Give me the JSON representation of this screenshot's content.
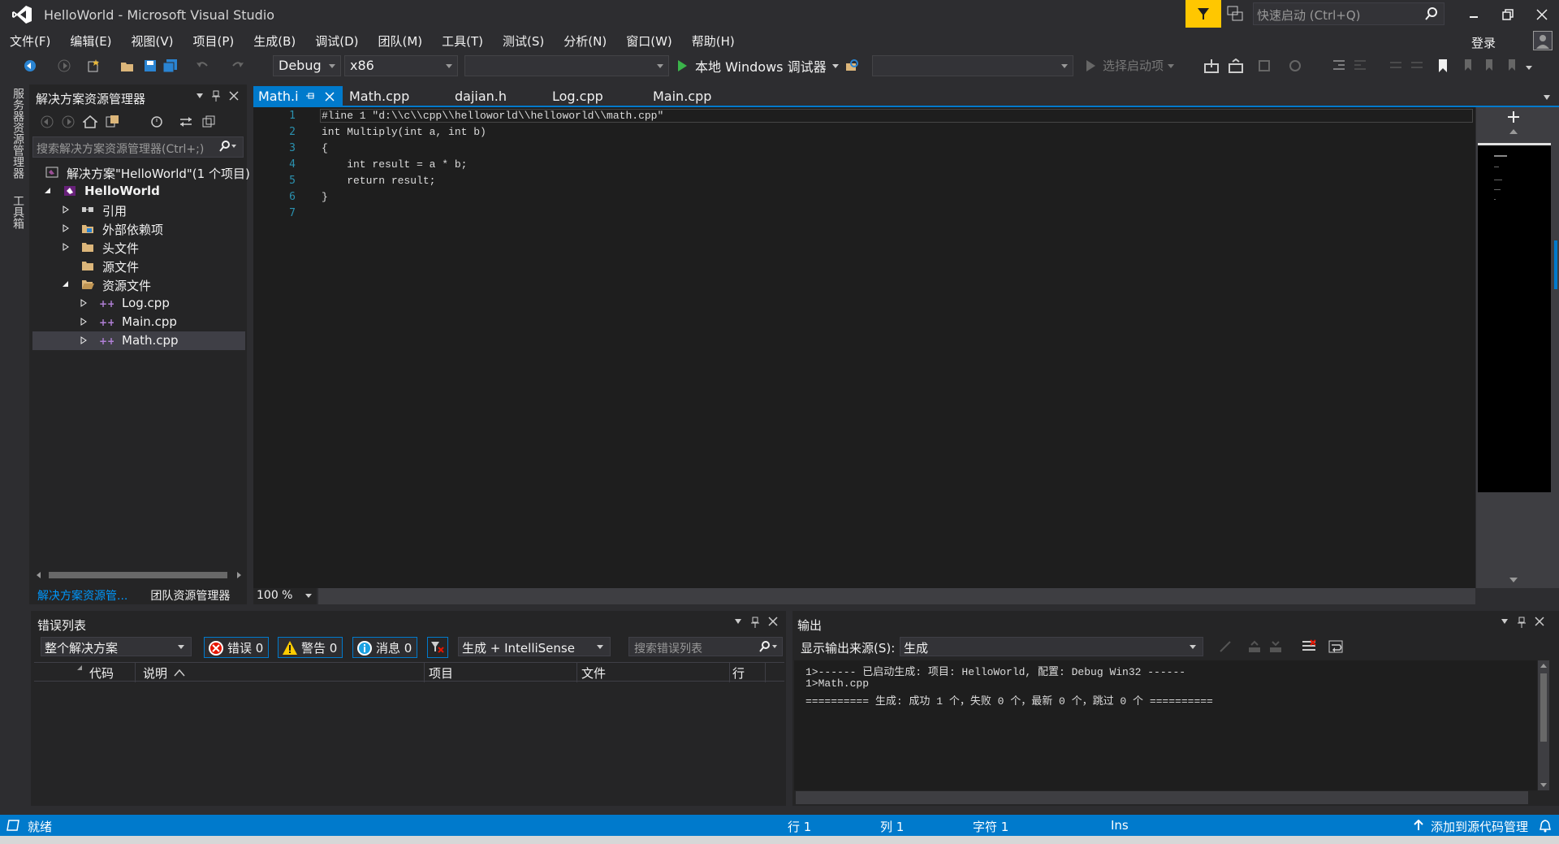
{
  "window": {
    "title": "HelloWorld - Microsoft Visual Studio",
    "quick_launch_placeholder": "快速启动 (Ctrl+Q)",
    "sign_in": "登录"
  },
  "menu": [
    "文件(F)",
    "编辑(E)",
    "视图(V)",
    "项目(P)",
    "生成(B)",
    "调试(D)",
    "团队(M)",
    "工具(T)",
    "测试(S)",
    "分析(N)",
    "窗口(W)",
    "帮助(H)"
  ],
  "toolbar": {
    "config": "Debug",
    "platform": "x86",
    "run_label": "本地 Windows 调试器",
    "startup_label": "选择启动项"
  },
  "side_tabs": [
    "服务器资源管理器",
    "工具箱"
  ],
  "solution_explorer": {
    "title": "解决方案资源管理器",
    "search_placeholder": "搜索解决方案资源管理器(Ctrl+;)",
    "tree": [
      {
        "label": "解决方案\"HelloWorld\"(1 个项目)",
        "icon": "solution-icon",
        "expander": ""
      },
      {
        "label": "HelloWorld",
        "icon": "project-icon",
        "expander": "expanded"
      },
      {
        "label": "引用",
        "icon": "references-icon",
        "expander": "collapsed"
      },
      {
        "label": "外部依赖项",
        "icon": "external-deps-icon",
        "expander": "collapsed"
      },
      {
        "label": "头文件",
        "icon": "folder-icon",
        "expander": "collapsed"
      },
      {
        "label": "源文件",
        "icon": "folder-icon",
        "expander": ""
      },
      {
        "label": "资源文件",
        "icon": "folder-open-icon",
        "expander": "expanded"
      },
      {
        "label": "Log.cpp",
        "icon": "cpp-file-icon",
        "expander": "collapsed"
      },
      {
        "label": "Main.cpp",
        "icon": "cpp-file-icon",
        "expander": "collapsed"
      },
      {
        "label": "Math.cpp",
        "icon": "cpp-file-icon",
        "expander": "collapsed",
        "selected": true
      }
    ],
    "bottom_tabs": [
      "解决方案资源管...",
      "团队资源管理器"
    ]
  },
  "editor": {
    "tabs": [
      "Math.i",
      "Math.cpp",
      "dajian.h",
      "Log.cpp",
      "Main.cpp"
    ],
    "active_tab": "Math.i",
    "zoom": "100 %",
    "lines": [
      "#line 1 \"d:\\\\c\\\\cpp\\\\helloworld\\\\helloworld\\\\math.cpp\"",
      "int Multiply(int a, int b)",
      "{",
      "    int result = a * b;",
      "    return result;",
      "}",
      ""
    ],
    "line_numbers": [
      "1",
      "2",
      "3",
      "4",
      "5",
      "6",
      "7"
    ]
  },
  "error_list": {
    "title": "错误列表",
    "scope": "整个解决方案",
    "errors": "错误 0",
    "warnings": "警告 0",
    "messages": "消息 0",
    "build_filter": "生成 + IntelliSense",
    "search_placeholder": "搜索错误列表",
    "columns": [
      "代码",
      "说明",
      "项目",
      "文件",
      "行"
    ]
  },
  "output": {
    "title": "输出",
    "source_label": "显示输出来源(S):",
    "source_value": "生成",
    "lines": [
      "1>------ 已启动生成: 项目: HelloWorld, 配置: Debug Win32 ------",
      "1>Math.cpp",
      "========== 生成: 成功 1 个，失败 0 个，最新 0 个，跳过 0 个 =========="
    ]
  },
  "status": {
    "state": "就绪",
    "row": "行 1",
    "col": "列 1",
    "char": "字符 1",
    "mode": "Ins",
    "source_control": "添加到源代码管理"
  },
  "colors": {
    "accent": "#007acc",
    "background": "#2d2d30",
    "editor": "#1e1e1e",
    "highlight": "#ffc700"
  }
}
